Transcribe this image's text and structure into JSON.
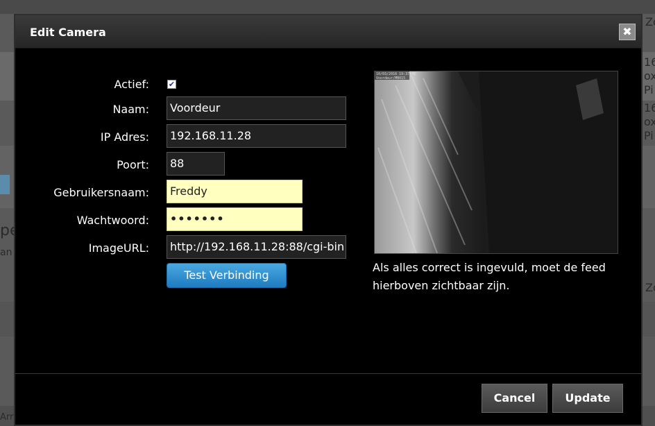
{
  "background": {
    "fragments": [
      "Zo",
      "16",
      "oxy",
      "Pi",
      "16",
      "oxy",
      "Pi",
      "pe",
      "an i",
      "Zo",
      "Arro"
    ]
  },
  "dialog": {
    "title": "Edit Camera",
    "close_icon": "close-icon",
    "close_glyph": "✖",
    "form": {
      "active_label": "Actief:",
      "active_checked": true,
      "name_label": "Naam:",
      "name_value": "Voordeur",
      "ip_label": "IP Adres:",
      "ip_value": "192.168.11.28",
      "port_label": "Poort:",
      "port_value": "88",
      "username_label": "Gebruikersnaam:",
      "username_value": "Freddy",
      "password_label": "Wachtwoord:",
      "password_value": "•••••••",
      "imageurl_label": "ImageURL:",
      "imageurl_value": "http://192.168.11.28:88/cgi-bin",
      "test_button": "Test Verbinding"
    },
    "camera": {
      "osd_line1": "10/03/2016 19:37:48",
      "osd_line2": "Voordeur/MB015"
    },
    "help_text": "Als alles correct is ingevuld, moet de feed hierboven zichtbaar zijn.",
    "buttons": {
      "cancel": "Cancel",
      "update": "Update"
    }
  },
  "colors": {
    "input_highlight": "#ffffc0",
    "accent_button": "#2a8fd3"
  }
}
